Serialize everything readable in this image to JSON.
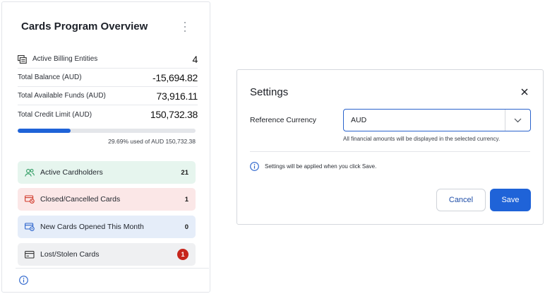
{
  "overview": {
    "title": "Cards Program Overview",
    "metrics": [
      {
        "label": "Active Billing Entities",
        "value": "4",
        "icon": "billing-entities-icon"
      },
      {
        "label": "Total Balance (AUD)",
        "value": "-15,694.82"
      },
      {
        "label": "Total Available Funds (AUD)",
        "value": "73,916.11"
      },
      {
        "label": "Total Credit Limit (AUD)",
        "value": "150,732.38"
      }
    ],
    "credit_usage": {
      "percent_used": 29.69,
      "caption": "29.69% used of AUD 150,732.38",
      "color": "#1f63d8"
    },
    "stats": [
      {
        "label": "Active Cardholders",
        "count": "21",
        "icon": "users-icon",
        "bg": "#e6f5ee",
        "icon_color": "#2e9b62"
      },
      {
        "label": "Closed/Cancelled Cards",
        "count": "1",
        "icon": "card-cancelled-icon",
        "bg": "#fbe7e7",
        "icon_color": "#d03a2b"
      },
      {
        "label": "New Cards Opened This Month",
        "count": "0",
        "icon": "card-new-icon",
        "bg": "#e5edf9",
        "icon_color": "#2a63cc"
      },
      {
        "label": "Lost/Stolen Cards",
        "count": "1",
        "icon": "card-icon",
        "bg": "#eff0f2",
        "badge_color": "#c6261c"
      }
    ]
  },
  "settings_dialog": {
    "title": "Settings",
    "reference_currency_label": "Reference Currency",
    "selected_currency": "AUD",
    "helper_text": "All financial amounts will be displayed in the selected currency.",
    "notice": "Settings will be applied when you click Save.",
    "cancel_label": "Cancel",
    "save_label": "Save",
    "accent_color": "#1f63d8"
  }
}
